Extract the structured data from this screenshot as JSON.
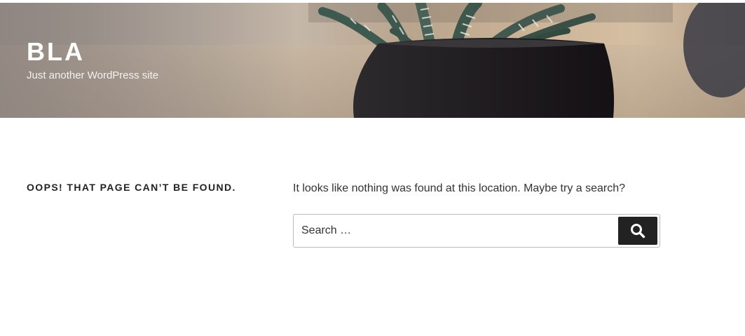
{
  "site": {
    "title": "BLA",
    "description": "Just another WordPress site"
  },
  "content": {
    "page_title": "Oops! That page can’t be found.",
    "message": "It looks like nothing was found at this location. Maybe try a search?"
  },
  "search": {
    "placeholder": "Search …",
    "value": "",
    "button_icon": "search-icon"
  },
  "colors": {
    "button_bg": "#222222",
    "title_text": "#222222",
    "header_text": "#ffffff"
  }
}
